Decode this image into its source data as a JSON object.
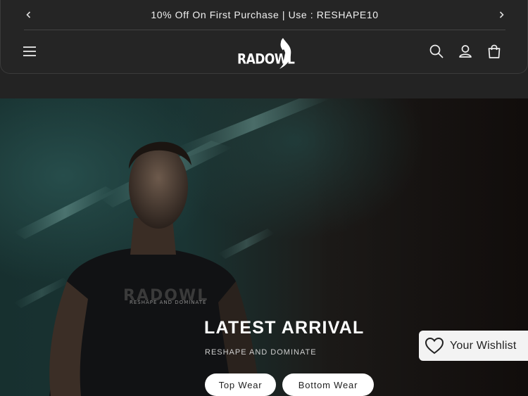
{
  "announcement": {
    "text": "10% Off On First Purchase | Use : RESHAPE10",
    "prev_icon": "chevron-left-icon",
    "next_icon": "chevron-right-icon"
  },
  "header": {
    "logo_text": "RADOWL",
    "icons": [
      "menu-icon",
      "search-icon",
      "account-icon",
      "cart-icon"
    ]
  },
  "hero": {
    "title": "LATEST ARRIVAL",
    "subtitle": "RESHAPE AND DOMINATE",
    "buttons": [
      {
        "label": "Top Wear"
      },
      {
        "label": "Bottom Wear"
      }
    ]
  },
  "wishlist": {
    "label": "Your Wishlist",
    "icon": "heart-icon"
  },
  "colors": {
    "header_bg": "#252525",
    "page_bg": "#232323",
    "button_bg": "#ffffff",
    "text_light": "#ffffff"
  }
}
